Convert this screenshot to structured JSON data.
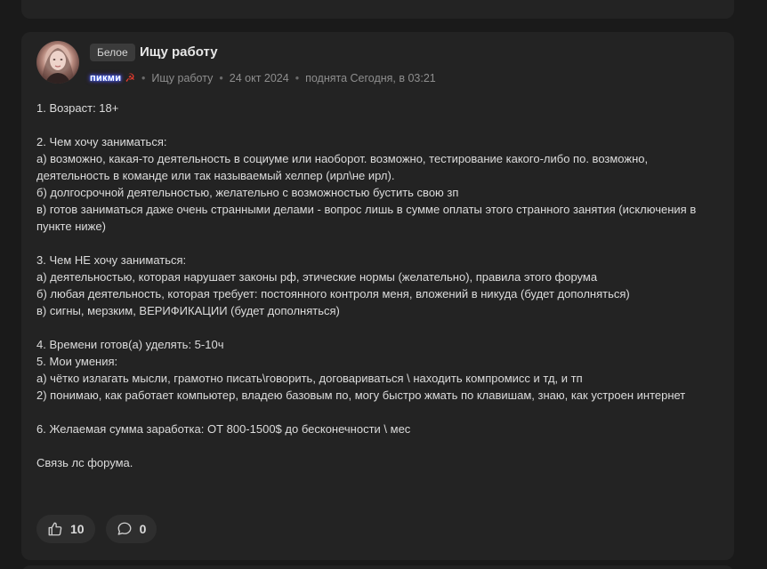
{
  "post": {
    "tag": "Белое",
    "title": "Ищу работу",
    "author": "пикми",
    "author_badge": "☭",
    "section": "Ищу работу",
    "date": "24 окт 2024",
    "bumped": "поднята Сегодня, в 03:21",
    "body_lines": [
      "1. Возраст: 18+",
      "",
      "2. Чем хочу заниматься:",
      "а) возможно, какая-то деятельность в социуме или наоборот. возможно, тестирование какого-либо по. возможно, деятельность в команде или так называемый хелпер (ирл\\не ирл).",
      "б) долгосрочной деятельностью, желательно с возможностью бустить свою зп",
      "в) готов заниматься даже очень странными делами - вопрос лишь в сумме оплаты этого странного занятия (исключения в пункте ниже)",
      "",
      "3. Чем НЕ хочу заниматься:",
      "а) деятельностью, которая нарушает законы рф, этические нормы (желательно), правила этого форума",
      "б) любая деятельность, которая требует: постоянного контроля меня, вложений в никуда (будет дополняться)",
      "в) сигны, мерзким, ВЕРИФИКАЦИИ (будет дополняться)",
      "",
      "4. Времени готов(а) уделять: 5-10ч",
      "5. Мои умения:",
      "а) чётко излагать мысли, грамотно писать\\говорить, договариваться \\ находить компромисс и тд, и тп",
      "2) понимаю, как работает компьютер, владею базовым по, могу быстро жмать по клавишам, знаю, как устроен интернет",
      "",
      "6. Желаемая сумма заработка: ОТ 800-1500$ до бесконечности \\ мес",
      "",
      "Связь лс форума."
    ],
    "likes": "10",
    "comments": "0"
  },
  "icons": {
    "like": "thumbs-up-icon",
    "comment": "comment-bubble-icon",
    "author_badge": "hammer-sickle-icon"
  },
  "colors": {
    "background": "#1a1a1a",
    "card": "#232323",
    "pill": "#2e2e2e",
    "tag": "#3b3b3b",
    "text": "#dcdcdc",
    "meta": "#8e8e8e"
  }
}
